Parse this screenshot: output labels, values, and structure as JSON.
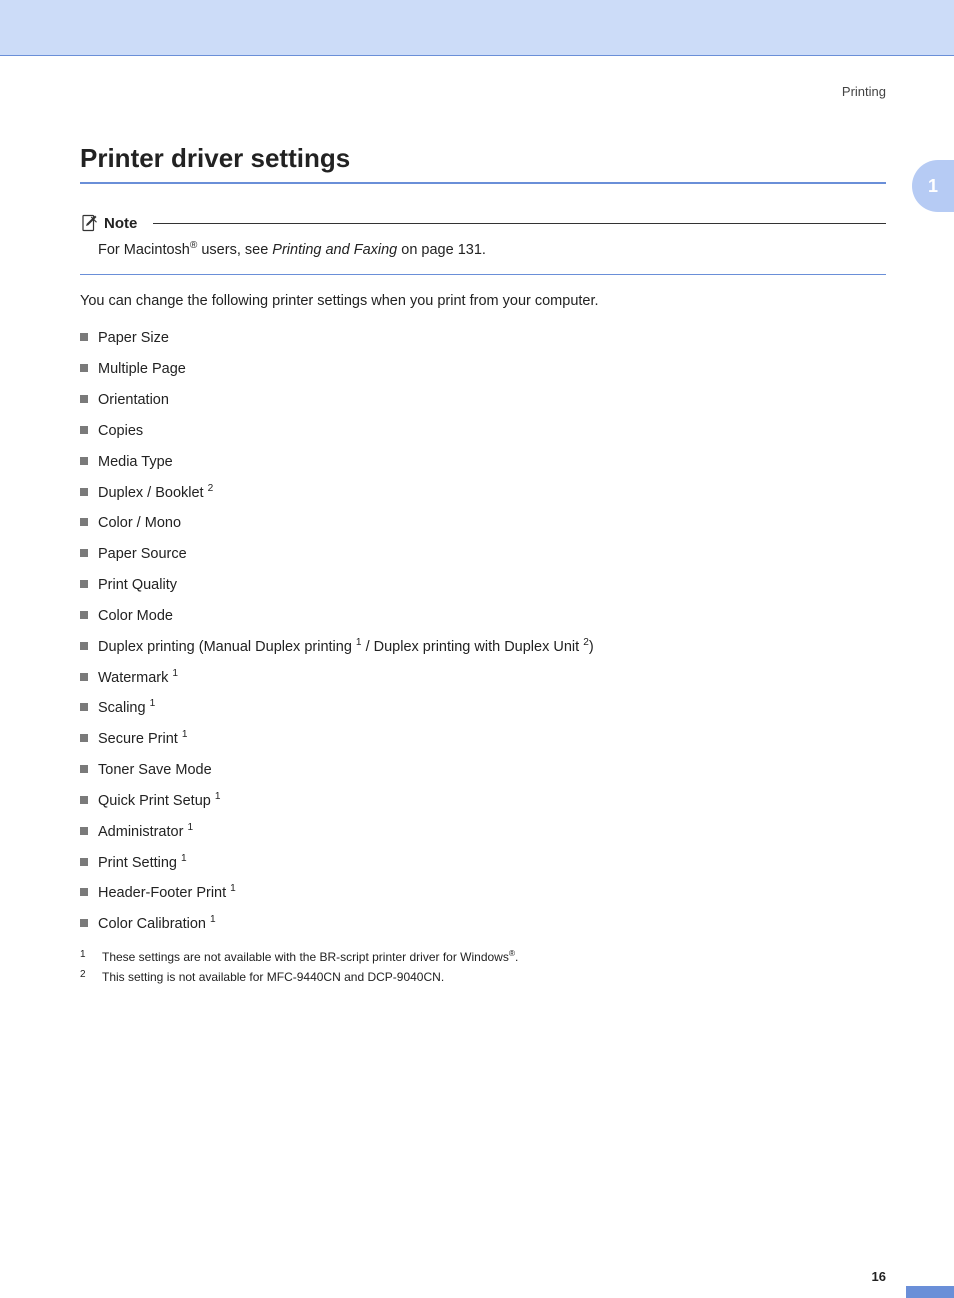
{
  "header": {
    "section_label": "Printing"
  },
  "sidebar": {
    "chapter_number": "1"
  },
  "title": "Printer driver settings",
  "note": {
    "label": "Note",
    "body_prefix": "For Macintosh",
    "body_reg": "®",
    "body_mid": " users, see ",
    "body_link": "Printing and Faxing",
    "body_suffix": " on page 131."
  },
  "intro": "You can change the following printer settings when you print from your computer.",
  "settings": [
    {
      "text": "Paper Size",
      "sup": ""
    },
    {
      "text": "Multiple Page",
      "sup": ""
    },
    {
      "text": "Orientation",
      "sup": ""
    },
    {
      "text": "Copies",
      "sup": ""
    },
    {
      "text": "Media Type",
      "sup": ""
    },
    {
      "text": "Duplex / Booklet ",
      "sup": "2"
    },
    {
      "text": "Color / Mono",
      "sup": ""
    },
    {
      "text": "Paper Source",
      "sup": ""
    },
    {
      "text": "Print Quality",
      "sup": ""
    },
    {
      "text": "Color Mode",
      "sup": ""
    },
    {
      "text_parts": {
        "a": "Duplex printing (Manual Duplex printing ",
        "s1": "1",
        "b": " / Duplex printing with Duplex Unit ",
        "s2": "2",
        "c": ")"
      }
    },
    {
      "text": "Watermark ",
      "sup": "1"
    },
    {
      "text": "Scaling ",
      "sup": "1"
    },
    {
      "text": "Secure Print ",
      "sup": "1"
    },
    {
      "text": "Toner Save Mode",
      "sup": ""
    },
    {
      "text": "Quick Print Setup ",
      "sup": "1"
    },
    {
      "text": "Administrator ",
      "sup": "1"
    },
    {
      "text": "Print Setting ",
      "sup": "1"
    },
    {
      "text": "Header-Footer Print ",
      "sup": "1"
    },
    {
      "text": "Color Calibration ",
      "sup": "1"
    }
  ],
  "footnotes": [
    {
      "num": "1",
      "text_a": "These settings are not available with the BR-script printer driver for Windows",
      "reg": "®",
      "text_b": "."
    },
    {
      "num": "2",
      "text_a": "This setting is not available for MFC-9440CN and DCP-9040CN.",
      "reg": "",
      "text_b": ""
    }
  ],
  "footer": {
    "page_number": "16"
  }
}
